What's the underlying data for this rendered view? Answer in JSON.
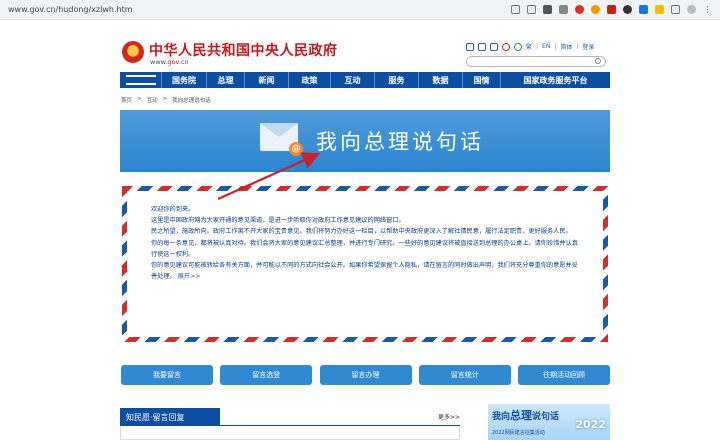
{
  "browser": {
    "url": "www.gov.cn/hudong/xzlwh.htm"
  },
  "header": {
    "site_title": "中华人民共和国中央人民政府",
    "site_domain_prefix": "www.",
    "site_domain_main": "gov",
    "site_domain_suffix": ".cn",
    "tools": {
      "lang_cn": "繁",
      "lang_en": "EN",
      "sep": "|",
      "service": "简体",
      "login": "登录"
    }
  },
  "nav": {
    "items": [
      "国务院",
      "总理",
      "新闻",
      "政策",
      "互动",
      "服务",
      "数据",
      "国情",
      "国家政务服务平台"
    ]
  },
  "breadcrumb": {
    "home": "首页",
    "sep": ">",
    "level1": "互动",
    "level2": "我向总理说句话"
  },
  "banner": {
    "title": "我向总理说句话",
    "at_symbol": "@"
  },
  "letter": {
    "greeting": "欢迎你的到来。",
    "p1": "这里是中国政府网为大家开通的意见渠道，是进一步听取你对政府工作意见建议的网络窗口。",
    "p2": "民之所望，施政所向。政府工作离不开大家的宝贵意见。我们将努力办好这一栏目，以帮助中央政府更深入了解社情民意，履行法定职责，更好服务人民。",
    "p3": "你的每一条意见，都将被认真对待。我们会将大家的意见建议汇总整理，并进行专门研究。一些好的意见建议将被直接送到总理的办公桌上。请你珍惜并认真行使这一权利。",
    "p4": "你的意见建议可能被转给各有关方面，并可能以不同的方式向社会公开。如果你希望保留个人隐私，请在留言的同时做出声明，我们将充分尊重你的意愿并妥善处理。",
    "expand": "展开>>"
  },
  "actions": [
    "我要留言",
    "留言选登",
    "留言办理",
    "留言统计",
    "往期活动回顾"
  ],
  "qa": {
    "title": "知民愿·留言回复",
    "more": "更多>>"
  },
  "promo": {
    "title_a": "我向",
    "title_b": "总理",
    "title_c": "说句话",
    "year": "2022",
    "subtitle": "2022网民建言征集活动"
  },
  "colors": {
    "brand_red": "#c8161d",
    "nav_blue": "#0b4ea2",
    "banner_blue": "#2a85d0",
    "button_blue": "#2f8ad2",
    "arrow_red": "#c8232c"
  }
}
